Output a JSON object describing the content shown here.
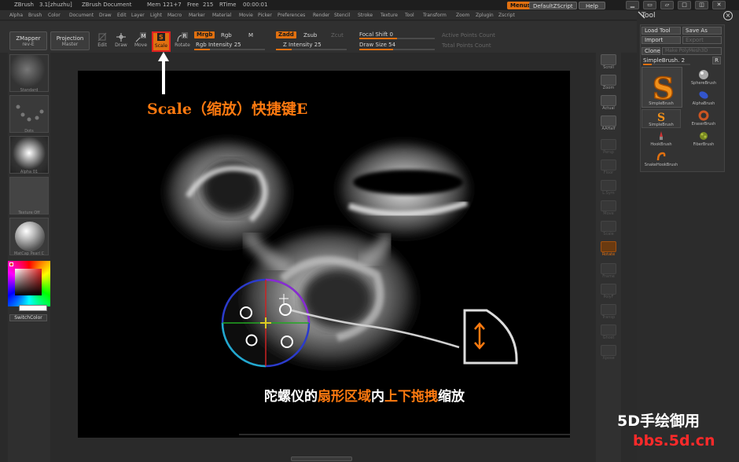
{
  "titlebar": {
    "app": "ZBrush",
    "version": "3.1[zhuzhu]",
    "document": "ZBrush Document",
    "mem": "Mem",
    "mem_val": "121+7",
    "free": "Free",
    "free_val": "215",
    "rtime": "RTime",
    "rtime_val": "00:00:01",
    "menus_btn": "Menus",
    "script_btn": "DefaultZScript",
    "help_btn": "Help"
  },
  "menubar": [
    "Alpha",
    "Brush",
    "Color",
    "Document",
    "Draw",
    "Edit",
    "Layer",
    "Light",
    "Macro",
    "Marker",
    "Material",
    "Movie",
    "Picker",
    "Preferences",
    "Render",
    "Stencil",
    "Stroke",
    "Texture",
    "Tool",
    "Transform",
    "Zoom",
    "Zplugin",
    "Zscript"
  ],
  "shelf": {
    "zmapper": "ZMapper",
    "zmapper_sub": "rev-E",
    "projection": "Projection",
    "projection_sub": "Master",
    "tools": [
      "Edit",
      "Draw",
      "Move",
      "Scale",
      "Rotate"
    ],
    "mrgb": "Mrgb",
    "rgb": "Rgb",
    "m": "M",
    "rgb_intensity": "Rgb Intensity",
    "rgb_intensity_val": "25",
    "zadd": "Zadd",
    "zsub": "Zsub",
    "zcut": "Zcut",
    "z_intensity": "Z Intensity",
    "z_intensity_val": "25",
    "focal_shift": "Focal Shift",
    "focal_shift_val": "0",
    "draw_size": "Draw Size",
    "draw_size_val": "54",
    "active_points": "Active Points Count",
    "total_points": "Total Points Count"
  },
  "leftpanel": {
    "standard": "Standard",
    "dots": "Dots",
    "alpha": "Alpha",
    "alpha_val": "01",
    "texture": "Texture",
    "texture_val": "Off",
    "matcap": "MatCap",
    "matcap_val": "Pearl C",
    "switch_color": "SwitchColor"
  },
  "rightcol": [
    "Scroll",
    "Zoom",
    "Actual",
    "AAHalf",
    "Persp",
    "Floor",
    "L.Sym",
    "Move",
    "Scale",
    "Rotate",
    "Frame",
    "PolyF",
    "Transp",
    "Ghost",
    "Xpose"
  ],
  "toolpanel": {
    "title": "Tool",
    "load_tool": "Load Tool",
    "save_as": "Save As",
    "import": "Import",
    "export": "Export",
    "clone": "Clone",
    "make_polymesh": "Make PolyMesh3D",
    "current_brush": "SimpleBrush.",
    "current_brush_num": "2",
    "r": "R",
    "brushes": [
      "SimpleBrush",
      "SphereBrush",
      "AlphaBrush",
      "SimpleBrush",
      "EraserBrush",
      "HookBrush",
      "FiberBrush",
      "SnakeHookBrush"
    ]
  },
  "annotations": {
    "scale_hint": "Scale（缩放）快捷键E",
    "gyro_prefix": "陀螺仪的",
    "gyro_region": "扇形区域",
    "gyro_mid": "内",
    "gyro_drag": "上下拖拽",
    "gyro_suffix": "缩放"
  },
  "watermark": {
    "line1": "5D手绘御用",
    "line2": "bbs.5d.cn"
  },
  "colors": {
    "accent": "#e07010",
    "annotation_orange": "#ff7a10",
    "highlight_red": "#e02020",
    "watermark_red": "#ff2a2a"
  }
}
